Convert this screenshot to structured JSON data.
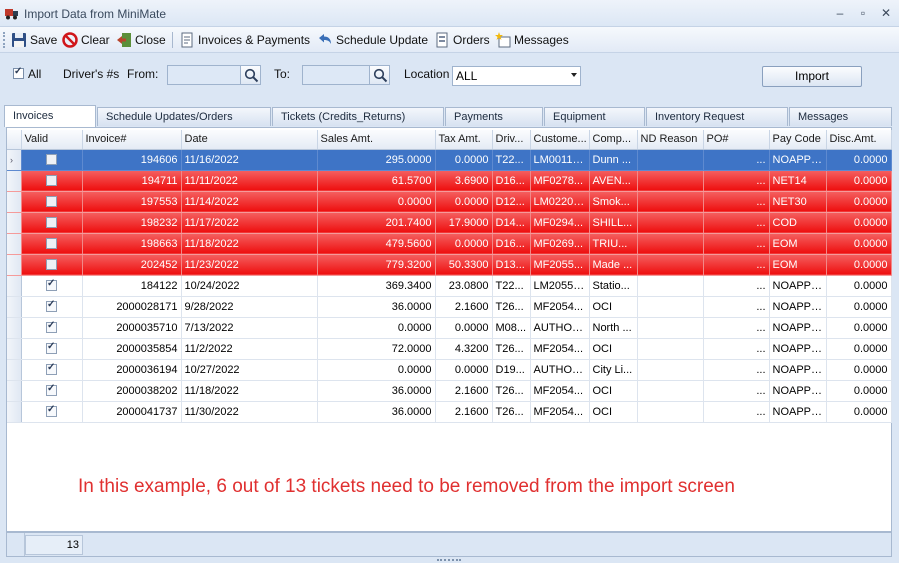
{
  "window": {
    "title": "Import Data from MiniMate"
  },
  "toolbar": {
    "save": "Save",
    "clear": "Clear",
    "close": "Close",
    "invoices_payments": "Invoices & Payments",
    "schedule_update": "Schedule Update",
    "orders": "Orders",
    "messages": "Messages"
  },
  "filter": {
    "all_label": "All",
    "all_checked": true,
    "drivers_label": "Driver's #s",
    "from_label": "From:",
    "to_label": "To:",
    "location_label": "Location",
    "location_value": "ALL",
    "import_button": "Import"
  },
  "tabs": [
    {
      "label": "Invoices",
      "active": true
    },
    {
      "label": "Schedule Updates/Orders"
    },
    {
      "label": "Tickets (Credits_Returns)"
    },
    {
      "label": "Payments"
    },
    {
      "label": "Equipment"
    },
    {
      "label": "Inventory Request"
    },
    {
      "label": "Messages"
    }
  ],
  "grid": {
    "columns": [
      "Valid",
      "Invoice#",
      "Date",
      "Sales Amt.",
      "Tax Amt.",
      "Driv...",
      "Custome...",
      "Comp...",
      "ND Reason",
      "PO#",
      "Pay Code",
      "Disc.Amt."
    ],
    "rows": [
      {
        "state": "selected",
        "valid": false,
        "invoice": "194606",
        "date": "11/16/2022",
        "sales": "295.0000",
        "tax": "0.0000",
        "driver": "T22...",
        "customer": "LM00118...",
        "company": "Dunn ...",
        "nd_reason": "",
        "po": "...",
        "pay_code": "NOAPPL...",
        "disc": "0.0000"
      },
      {
        "state": "invalid",
        "valid": false,
        "invoice": "194711",
        "date": "11/11/2022",
        "sales": "61.5700",
        "tax": "3.6900",
        "driver": "D16...",
        "customer": "MF0278...",
        "company": "AVEN...",
        "nd_reason": "",
        "po": "...",
        "pay_code": "NET14",
        "disc": "0.0000"
      },
      {
        "state": "invalid",
        "valid": false,
        "invoice": "197553",
        "date": "11/14/2022",
        "sales": "0.0000",
        "tax": "0.0000",
        "driver": "D12...",
        "customer": "LM02200...",
        "company": "Smok...",
        "nd_reason": "",
        "po": "...",
        "pay_code": "NET30",
        "disc": "0.0000"
      },
      {
        "state": "invalid",
        "valid": false,
        "invoice": "198232",
        "date": "11/17/2022",
        "sales": "201.7400",
        "tax": "17.9000",
        "driver": "D14...",
        "customer": "MF0294...",
        "company": "SHILL...",
        "nd_reason": "",
        "po": "...",
        "pay_code": "COD",
        "disc": "0.0000"
      },
      {
        "state": "invalid",
        "valid": false,
        "invoice": "198663",
        "date": "11/18/2022",
        "sales": "479.5600",
        "tax": "0.0000",
        "driver": "D16...",
        "customer": "MF0269...",
        "company": "TRIU...",
        "nd_reason": "",
        "po": "...",
        "pay_code": "EOM",
        "disc": "0.0000"
      },
      {
        "state": "invalid",
        "valid": false,
        "invoice": "202452",
        "date": "11/23/2022",
        "sales": "779.3200",
        "tax": "50.3300",
        "driver": "D13...",
        "customer": "MF2055...",
        "company": "Made ...",
        "nd_reason": "",
        "po": "...",
        "pay_code": "EOM",
        "disc": "0.0000"
      },
      {
        "state": "normal",
        "valid": true,
        "invoice": "184122",
        "date": "10/24/2022",
        "sales": "369.3400",
        "tax": "23.0800",
        "driver": "T22...",
        "customer": "LM20554...",
        "company": "Statio...",
        "nd_reason": "",
        "po": "...",
        "pay_code": "NOAPPL...",
        "disc": "0.0000"
      },
      {
        "state": "normal",
        "valid": true,
        "invoice": "2000028171",
        "date": "9/28/2022",
        "sales": "36.0000",
        "tax": "2.1600",
        "driver": "T26...",
        "customer": "MF2054...",
        "company": "OCI",
        "nd_reason": "",
        "po": "...",
        "pay_code": "NOAPPL...",
        "disc": "0.0000"
      },
      {
        "state": "normal",
        "valid": true,
        "invoice": "2000035710",
        "date": "7/13/2022",
        "sales": "0.0000",
        "tax": "0.0000",
        "driver": "M08...",
        "customer": "AUTHOR...",
        "company": "North ...",
        "nd_reason": "",
        "po": "...",
        "pay_code": "NOAPPL...",
        "disc": "0.0000"
      },
      {
        "state": "normal",
        "valid": true,
        "invoice": "2000035854",
        "date": "11/2/2022",
        "sales": "72.0000",
        "tax": "4.3200",
        "driver": "T26...",
        "customer": "MF2054...",
        "company": "OCI",
        "nd_reason": "",
        "po": "...",
        "pay_code": "NOAPPL...",
        "disc": "0.0000"
      },
      {
        "state": "normal",
        "valid": true,
        "invoice": "2000036194",
        "date": "10/27/2022",
        "sales": "0.0000",
        "tax": "0.0000",
        "driver": "D19...",
        "customer": "AUTHOR...",
        "company": "City Li...",
        "nd_reason": "",
        "po": "...",
        "pay_code": "NOAPPL...",
        "disc": "0.0000"
      },
      {
        "state": "normal",
        "valid": true,
        "invoice": "2000038202",
        "date": "11/18/2022",
        "sales": "36.0000",
        "tax": "2.1600",
        "driver": "T26...",
        "customer": "MF2054...",
        "company": "OCI",
        "nd_reason": "",
        "po": "...",
        "pay_code": "NOAPPL...",
        "disc": "0.0000"
      },
      {
        "state": "normal",
        "valid": true,
        "invoice": "2000041737",
        "date": "11/30/2022",
        "sales": "36.0000",
        "tax": "2.1600",
        "driver": "T26...",
        "customer": "MF2054...",
        "company": "OCI",
        "nd_reason": "",
        "po": "...",
        "pay_code": "NOAPPL...",
        "disc": "0.0000"
      }
    ]
  },
  "note": "In this example, 6 out of 13 tickets need to be removed from the import screen",
  "footer": {
    "count": "13"
  },
  "colors": {
    "invalid_row": "#ee0e0e",
    "selected_row": "#3e74c6",
    "note_text": "#e03030"
  }
}
